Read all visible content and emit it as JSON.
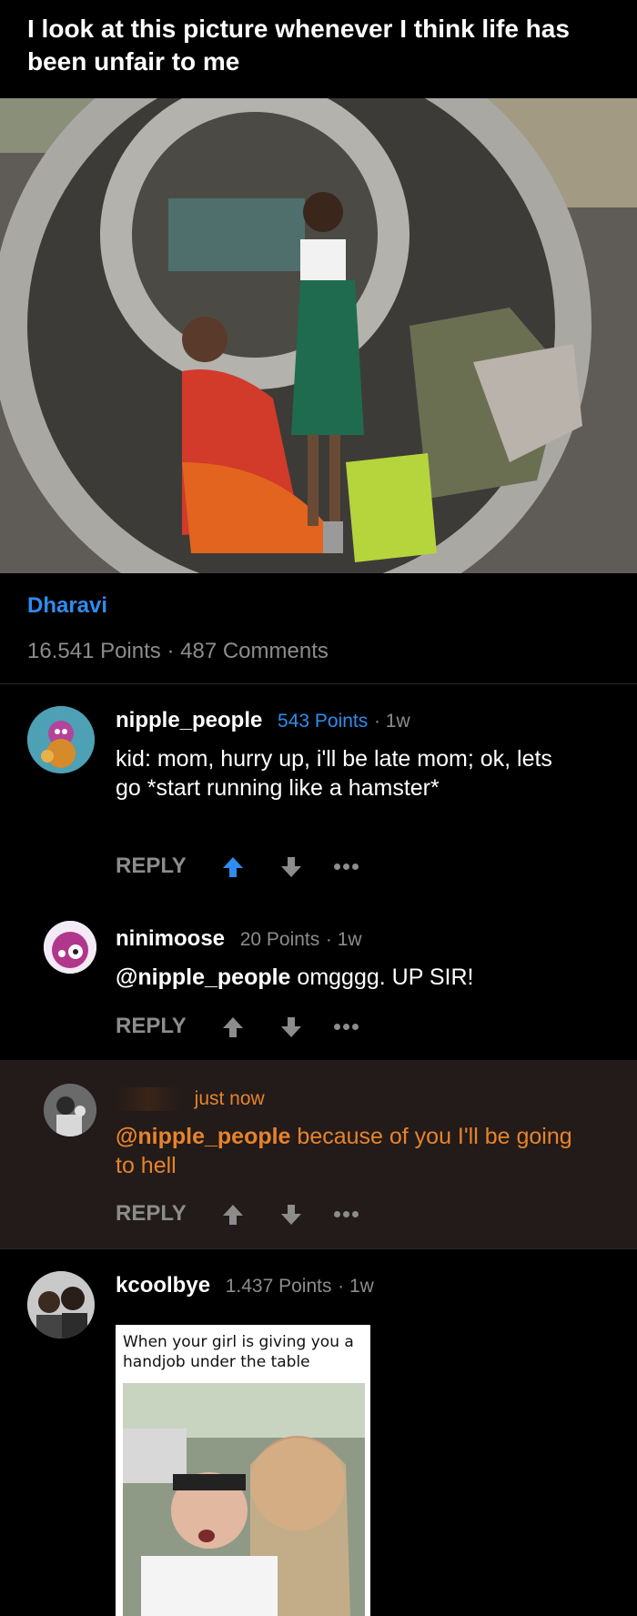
{
  "post": {
    "title": "I look at this picture whenever I think life has been unfair to me",
    "tag": "Dharavi",
    "points": "16.541 Points",
    "separator": "·",
    "comments": "487 Comments"
  },
  "comments": [
    {
      "username": "nipple_people",
      "points": "543 Points",
      "time": "· 1w",
      "text": "kid: mom, hurry up, i'll be late mom; ok, lets go *start running like a hamster*",
      "reply_label": "REPLY",
      "upvoted": true
    },
    {
      "username": "ninimoose",
      "points": "20 Points",
      "time": "· 1w",
      "mention": "@nipple_people",
      "text": " omgggg. UP SIR!",
      "reply_label": "REPLY"
    },
    {
      "username": "",
      "time": "just now",
      "mention": "@nipple_people",
      "text": " because of you I'll be going to hell",
      "reply_label": "REPLY"
    },
    {
      "username": "kcoolbye",
      "points": "1.437 Points",
      "time": "· 1w",
      "meme_caption": "When your girl is giving you a handjob under the table"
    }
  ],
  "colors": {
    "background": "#000000",
    "accent_blue": "#2f8cf0",
    "highlight_bg": "#221b19",
    "highlight_text": "#e8832b",
    "muted": "#8c8c8c"
  },
  "icons": [
    "upvote-icon",
    "downvote-icon",
    "more-options-icon"
  ]
}
